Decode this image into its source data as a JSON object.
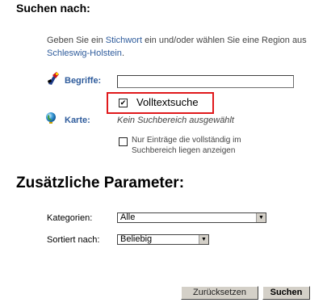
{
  "header": {
    "title": "Suchen nach:"
  },
  "intro": {
    "part1": "Geben Sie ein ",
    "link_stichwort": "Stichwort",
    "part2": " ein und/oder wählen Sie eine Region aus ",
    "link_region": "Schleswig-Holstein",
    "part3": "."
  },
  "search": {
    "begriffe_label": "Begriffe:",
    "input_value": "",
    "volltext_checked": true,
    "volltext_label": "Volltextsuche",
    "karte_label": "Karte:",
    "karte_status": "Kein Suchbereich ausgewählt",
    "nur_checked": false,
    "nur_label": "Nur Einträge die vollständig im Suchbereich liegen anzeigen"
  },
  "params": {
    "title": "Zusätzliche Parameter:",
    "kategorien_label": "Kategorien:",
    "kategorien_value": "Alle",
    "sortiert_label": "Sortiert nach:",
    "sortiert_value": "Beliebig"
  },
  "buttons": {
    "reset": "Zurücksetzen",
    "search": "Suchen"
  },
  "colors": {
    "accent_link": "#2f5c9c",
    "highlight_border": "#e0191c"
  },
  "icons": {
    "begriffe": "key-hand-icon",
    "karte": "globe-icon",
    "dropdown": "chevron-down-icon"
  }
}
